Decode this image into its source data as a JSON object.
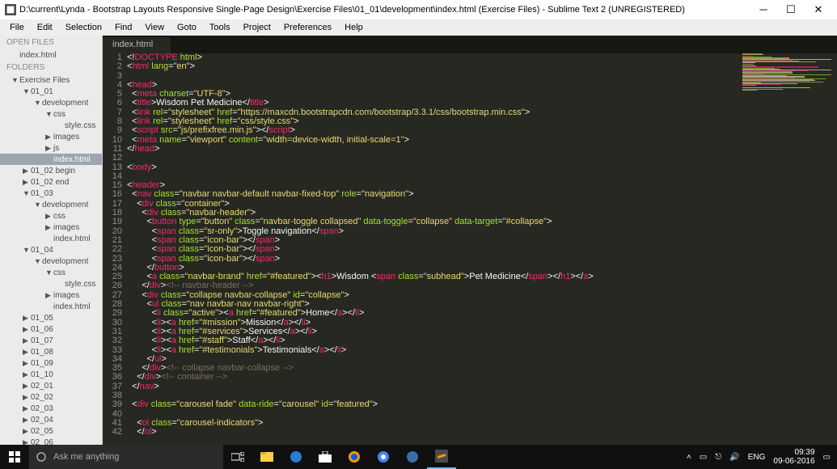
{
  "window": {
    "title": "D:\\current\\Lynda - Bootstrap Layouts Responsive Single-Page Design\\Exercise Files\\01_01\\development\\index.html (Exercise Files) - Sublime Text 2 (UNREGISTERED)"
  },
  "menubar": [
    "File",
    "Edit",
    "Selection",
    "Find",
    "View",
    "Goto",
    "Tools",
    "Project",
    "Preferences",
    "Help"
  ],
  "sidebar": {
    "open_files_header": "OPEN FILES",
    "open_files": [
      "index.html"
    ],
    "folders_header": "FOLDERS",
    "tree": [
      {
        "label": "Exercise Files",
        "arrow": "▼",
        "indent": 1
      },
      {
        "label": "01_01",
        "arrow": "▼",
        "indent": 2
      },
      {
        "label": "development",
        "arrow": "▼",
        "indent": 3
      },
      {
        "label": "css",
        "arrow": "▼",
        "indent": 4
      },
      {
        "label": "style.css",
        "arrow": "",
        "indent": 5
      },
      {
        "label": "images",
        "arrow": "▶",
        "indent": 4
      },
      {
        "label": "js",
        "arrow": "▶",
        "indent": 4
      },
      {
        "label": "index.html",
        "arrow": "",
        "indent": 4,
        "selected": true
      },
      {
        "label": "01_02 begin",
        "arrow": "▶",
        "indent": 2
      },
      {
        "label": "01_02 end",
        "arrow": "▶",
        "indent": 2
      },
      {
        "label": "01_03",
        "arrow": "▼",
        "indent": 2
      },
      {
        "label": "development",
        "arrow": "▼",
        "indent": 3
      },
      {
        "label": "css",
        "arrow": "▶",
        "indent": 4
      },
      {
        "label": "images",
        "arrow": "▶",
        "indent": 4
      },
      {
        "label": "index.html",
        "arrow": "",
        "indent": 4
      },
      {
        "label": "01_04",
        "arrow": "▼",
        "indent": 2
      },
      {
        "label": "development",
        "arrow": "▼",
        "indent": 3
      },
      {
        "label": "css",
        "arrow": "▼",
        "indent": 4
      },
      {
        "label": "style.css",
        "arrow": "",
        "indent": 5
      },
      {
        "label": "images",
        "arrow": "▶",
        "indent": 4
      },
      {
        "label": "index.html",
        "arrow": "",
        "indent": 4
      },
      {
        "label": "01_05",
        "arrow": "▶",
        "indent": 2
      },
      {
        "label": "01_06",
        "arrow": "▶",
        "indent": 2
      },
      {
        "label": "01_07",
        "arrow": "▶",
        "indent": 2
      },
      {
        "label": "01_08",
        "arrow": "▶",
        "indent": 2
      },
      {
        "label": "01_09",
        "arrow": "▶",
        "indent": 2
      },
      {
        "label": "01_10",
        "arrow": "▶",
        "indent": 2
      },
      {
        "label": "02_01",
        "arrow": "▶",
        "indent": 2
      },
      {
        "label": "02_02",
        "arrow": "▶",
        "indent": 2
      },
      {
        "label": "02_03",
        "arrow": "▶",
        "indent": 2
      },
      {
        "label": "02_04",
        "arrow": "▶",
        "indent": 2
      },
      {
        "label": "02_05",
        "arrow": "▶",
        "indent": 2
      },
      {
        "label": "02_06",
        "arrow": "▶",
        "indent": 2
      }
    ]
  },
  "tab": {
    "label": "index.html"
  },
  "code_lines": [
    {
      "n": 1,
      "html": "<span class='c-punct'>&lt;!</span><span class='c-tag'>DOCTYPE</span> <span class='c-attr'>html</span><span class='c-punct'>&gt;</span>"
    },
    {
      "n": 2,
      "html": "<span class='c-punct'>&lt;</span><span class='c-tag'>html</span> <span class='c-attr'>lang</span><span class='c-punct'>=</span><span class='c-str'>\"en\"</span><span class='c-punct'>&gt;</span>"
    },
    {
      "n": 3,
      "html": ""
    },
    {
      "n": 4,
      "html": "<span class='c-punct'>&lt;</span><span class='c-tag'>head</span><span class='c-punct'>&gt;</span>"
    },
    {
      "n": 5,
      "html": "  <span class='c-punct'>&lt;</span><span class='c-tag'>meta</span> <span class='c-attr'>charset</span><span class='c-punct'>=</span><span class='c-str'>\"UTF-8\"</span><span class='c-punct'>&gt;</span>"
    },
    {
      "n": 6,
      "html": "  <span class='c-punct'>&lt;</span><span class='c-tag'>title</span><span class='c-punct'>&gt;</span><span class='c-text'>Wisdom Pet Medicine</span><span class='c-punct'>&lt;/</span><span class='c-tag'>title</span><span class='c-punct'>&gt;</span>"
    },
    {
      "n": 7,
      "html": "  <span class='c-punct'>&lt;</span><span class='c-tag'>link</span> <span class='c-attr'>rel</span><span class='c-punct'>=</span><span class='c-str'>\"stylesheet\"</span> <span class='c-attr'>href</span><span class='c-punct'>=</span><span class='c-str'>\"https://maxcdn.bootstrapcdn.com/bootstrap/3.3.1/css/bootstrap.min.css\"</span><span class='c-punct'>&gt;</span>"
    },
    {
      "n": 8,
      "html": "  <span class='c-punct'>&lt;</span><span class='c-tag'>link</span> <span class='c-attr'>rel</span><span class='c-punct'>=</span><span class='c-str'>\"stylesheet\"</span> <span class='c-attr'>href</span><span class='c-punct'>=</span><span class='c-str'>\"css/style.css\"</span><span class='c-punct'>&gt;</span>"
    },
    {
      "n": 9,
      "html": "  <span class='c-punct'>&lt;</span><span class='c-tag'>script</span> <span class='c-attr'>src</span><span class='c-punct'>=</span><span class='c-str'>\"js/prefixfree.min.js\"</span><span class='c-punct'>&gt;&lt;/</span><span class='c-tag'>script</span><span class='c-punct'>&gt;</span>"
    },
    {
      "n": 10,
      "html": "  <span class='c-punct'>&lt;</span><span class='c-tag'>meta</span> <span class='c-attr'>name</span><span class='c-punct'>=</span><span class='c-str'>\"viewport\"</span> <span class='c-attr'>content</span><span class='c-punct'>=</span><span class='c-str'>\"width=device-width, initial-scale=1\"</span><span class='c-punct'>&gt;</span>"
    },
    {
      "n": 11,
      "html": "<span class='c-punct'>&lt;/</span><span class='c-tag'>head</span><span class='c-punct'>&gt;</span>"
    },
    {
      "n": 12,
      "html": ""
    },
    {
      "n": 13,
      "html": "<span class='c-punct'>&lt;</span><span class='c-tag'>body</span><span class='c-punct'>&gt;</span>"
    },
    {
      "n": 14,
      "html": ""
    },
    {
      "n": 15,
      "html": "<span class='c-punct'>&lt;</span><span class='c-tag'>header</span><span class='c-punct'>&gt;</span>"
    },
    {
      "n": 16,
      "html": "  <span class='c-punct'>&lt;</span><span class='c-tag'>nav</span> <span class='c-attr'>class</span><span class='c-punct'>=</span><span class='c-str'>\"navbar navbar-default navbar-fixed-top\"</span> <span class='c-attr'>role</span><span class='c-punct'>=</span><span class='c-str'>\"navigation\"</span><span class='c-punct'>&gt;</span>"
    },
    {
      "n": 17,
      "html": "    <span class='c-punct'>&lt;</span><span class='c-tag'>div</span> <span class='c-attr'>class</span><span class='c-punct'>=</span><span class='c-str'>\"container\"</span><span class='c-punct'>&gt;</span>"
    },
    {
      "n": 18,
      "html": "      <span class='c-punct'>&lt;</span><span class='c-tag'>div</span> <span class='c-attr'>class</span><span class='c-punct'>=</span><span class='c-str'>\"navbar-header\"</span><span class='c-punct'>&gt;</span>"
    },
    {
      "n": 19,
      "html": "        <span class='c-punct'>&lt;</span><span class='c-tag'>button</span> <span class='c-attr'>type</span><span class='c-punct'>=</span><span class='c-str'>\"button\"</span> <span class='c-attr'>class</span><span class='c-punct'>=</span><span class='c-str'>\"navbar-toggle collapsed\"</span> <span class='c-attr'>data-toggle</span><span class='c-punct'>=</span><span class='c-str'>\"collapse\"</span> <span class='c-attr'>data-target</span><span class='c-punct'>=</span><span class='c-str'>\"#collapse\"</span><span class='c-punct'>&gt;</span>"
    },
    {
      "n": 20,
      "html": "          <span class='c-punct'>&lt;</span><span class='c-tag'>span</span> <span class='c-attr'>class</span><span class='c-punct'>=</span><span class='c-str'>\"sr-only\"</span><span class='c-punct'>&gt;</span><span class='c-text'>Toggle navigation</span><span class='c-punct'>&lt;/</span><span class='c-tag'>span</span><span class='c-punct'>&gt;</span>"
    },
    {
      "n": 21,
      "html": "          <span class='c-punct'>&lt;</span><span class='c-tag'>span</span> <span class='c-attr'>class</span><span class='c-punct'>=</span><span class='c-str'>\"icon-bar\"</span><span class='c-punct'>&gt;&lt;/</span><span class='c-tag'>span</span><span class='c-punct'>&gt;</span>"
    },
    {
      "n": 22,
      "html": "          <span class='c-punct'>&lt;</span><span class='c-tag'>span</span> <span class='c-attr'>class</span><span class='c-punct'>=</span><span class='c-str'>\"icon-bar\"</span><span class='c-punct'>&gt;&lt;/</span><span class='c-tag'>span</span><span class='c-punct'>&gt;</span>"
    },
    {
      "n": 23,
      "html": "          <span class='c-punct'>&lt;</span><span class='c-tag'>span</span> <span class='c-attr'>class</span><span class='c-punct'>=</span><span class='c-str'>\"icon-bar\"</span><span class='c-punct'>&gt;&lt;/</span><span class='c-tag'>span</span><span class='c-punct'>&gt;</span>"
    },
    {
      "n": 24,
      "html": "        <span class='c-punct'>&lt;/</span><span class='c-tag'>button</span><span class='c-punct'>&gt;</span>"
    },
    {
      "n": 25,
      "html": "        <span class='c-punct'>&lt;</span><span class='c-tag'>a</span> <span class='c-attr'>class</span><span class='c-punct'>=</span><span class='c-str'>\"navbar-brand\"</span> <span class='c-attr'>href</span><span class='c-punct'>=</span><span class='c-str'>\"#featured\"</span><span class='c-punct'>&gt;&lt;</span><span class='c-tag'>h1</span><span class='c-punct'>&gt;</span><span class='c-text'>Wisdom </span><span class='c-punct'>&lt;</span><span class='c-tag'>span</span> <span class='c-attr'>class</span><span class='c-punct'>=</span><span class='c-str'>\"subhead\"</span><span class='c-punct'>&gt;</span><span class='c-text'>Pet Medicine</span><span class='c-punct'>&lt;/</span><span class='c-tag'>span</span><span class='c-punct'>&gt;&lt;/</span><span class='c-tag'>h1</span><span class='c-punct'>&gt;&lt;/</span><span class='c-tag'>a</span><span class='c-punct'>&gt;</span>"
    },
    {
      "n": 26,
      "html": "      <span class='c-punct'>&lt;/</span><span class='c-tag'>div</span><span class='c-punct'>&gt;</span><span class='c-comment'>&lt;!-- navbar-header --&gt;</span>"
    },
    {
      "n": 27,
      "html": "      <span class='c-punct'>&lt;</span><span class='c-tag'>div</span> <span class='c-attr'>class</span><span class='c-punct'>=</span><span class='c-str'>\"collapse navbar-collapse\"</span> <span class='c-attr'>id</span><span class='c-punct'>=</span><span class='c-str'>\"collapse\"</span><span class='c-punct'>&gt;</span>"
    },
    {
      "n": 28,
      "html": "        <span class='c-punct'>&lt;</span><span class='c-tag'>ul</span> <span class='c-attr'>class</span><span class='c-punct'>=</span><span class='c-str'>\"nav navbar-nav navbar-right\"</span><span class='c-punct'>&gt;</span>"
    },
    {
      "n": 29,
      "html": "          <span class='c-punct'>&lt;</span><span class='c-tag'>li</span> <span class='c-attr'>class</span><span class='c-punct'>=</span><span class='c-str'>\"active\"</span><span class='c-punct'>&gt;&lt;</span><span class='c-tag'>a</span> <span class='c-attr'>href</span><span class='c-punct'>=</span><span class='c-str'>\"#featured\"</span><span class='c-punct'>&gt;</span><span class='c-text'>Home</span><span class='c-punct'>&lt;/</span><span class='c-tag'>a</span><span class='c-punct'>&gt;&lt;/</span><span class='c-tag'>li</span><span class='c-punct'>&gt;</span>"
    },
    {
      "n": 30,
      "html": "          <span class='c-punct'>&lt;</span><span class='c-tag'>li</span><span class='c-punct'>&gt;&lt;</span><span class='c-tag'>a</span> <span class='c-attr'>href</span><span class='c-punct'>=</span><span class='c-str'>\"#mission\"</span><span class='c-punct'>&gt;</span><span class='c-text'>Mission</span><span class='c-punct'>&lt;/</span><span class='c-tag'>a</span><span class='c-punct'>&gt;&lt;/</span><span class='c-tag'>li</span><span class='c-punct'>&gt;</span>"
    },
    {
      "n": 31,
      "html": "          <span class='c-punct'>&lt;</span><span class='c-tag'>li</span><span class='c-punct'>&gt;&lt;</span><span class='c-tag'>a</span> <span class='c-attr'>href</span><span class='c-punct'>=</span><span class='c-str'>\"#services\"</span><span class='c-punct'>&gt;</span><span class='c-text'>Services</span><span class='c-punct'>&lt;/</span><span class='c-tag'>a</span><span class='c-punct'>&gt;&lt;/</span><span class='c-tag'>li</span><span class='c-punct'>&gt;</span>"
    },
    {
      "n": 32,
      "html": "          <span class='c-punct'>&lt;</span><span class='c-tag'>li</span><span class='c-punct'>&gt;&lt;</span><span class='c-tag'>a</span> <span class='c-attr'>href</span><span class='c-punct'>=</span><span class='c-str'>\"#staff\"</span><span class='c-punct'>&gt;</span><span class='c-text'>Staff</span><span class='c-punct'>&lt;/</span><span class='c-tag'>a</span><span class='c-punct'>&gt;&lt;/</span><span class='c-tag'>li</span><span class='c-punct'>&gt;</span>"
    },
    {
      "n": 33,
      "html": "          <span class='c-punct'>&lt;</span><span class='c-tag'>li</span><span class='c-punct'>&gt;&lt;</span><span class='c-tag'>a</span> <span class='c-attr'>href</span><span class='c-punct'>=</span><span class='c-str'>\"#testimonials\"</span><span class='c-punct'>&gt;</span><span class='c-text'>Testimonials</span><span class='c-punct'>&lt;/</span><span class='c-tag'>a</span><span class='c-punct'>&gt;&lt;/</span><span class='c-tag'>li</span><span class='c-punct'>&gt;</span>"
    },
    {
      "n": 34,
      "html": "        <span class='c-punct'>&lt;/</span><span class='c-tag'>ul</span><span class='c-punct'>&gt;</span>"
    },
    {
      "n": 35,
      "html": "      <span class='c-punct'>&lt;/</span><span class='c-tag'>div</span><span class='c-punct'>&gt;</span><span class='c-comment'>&lt;!-- collapse navbar-collapse --&gt;</span>"
    },
    {
      "n": 36,
      "html": "    <span class='c-punct'>&lt;/</span><span class='c-tag'>div</span><span class='c-punct'>&gt;</span><span class='c-comment'>&lt;!-- container --&gt;</span>"
    },
    {
      "n": 37,
      "html": "  <span class='c-punct'>&lt;/</span><span class='c-tag'>nav</span><span class='c-punct'>&gt;</span>"
    },
    {
      "n": 38,
      "html": ""
    },
    {
      "n": 39,
      "html": "  <span class='c-punct'>&lt;</span><span class='c-tag'>div</span> <span class='c-attr'>class</span><span class='c-punct'>=</span><span class='c-str'>\"carousel fade\"</span> <span class='c-attr'>data-ride</span><span class='c-punct'>=</span><span class='c-str'>\"carousel\"</span> <span class='c-attr'>id</span><span class='c-punct'>=</span><span class='c-str'>\"featured\"</span><span class='c-punct'>&gt;</span>"
    },
    {
      "n": 40,
      "html": ""
    },
    {
      "n": 41,
      "html": "    <span class='c-punct'>&lt;</span><span class='c-tag'>ol</span> <span class='c-attr'>class</span><span class='c-punct'>=</span><span class='c-str'>\"carousel-indicators\"</span><span class='c-punct'>&gt;</span>"
    },
    {
      "n": 42,
      "html": "    <span class='c-punct'>&lt;/</span><span class='c-tag'>ol</span><span class='c-punct'>&gt;</span>"
    }
  ],
  "taskbar": {
    "search_placeholder": "Ask me anything",
    "tray_lang": "ENG",
    "tray_time": "09:39",
    "tray_date": "09-06-2016"
  }
}
